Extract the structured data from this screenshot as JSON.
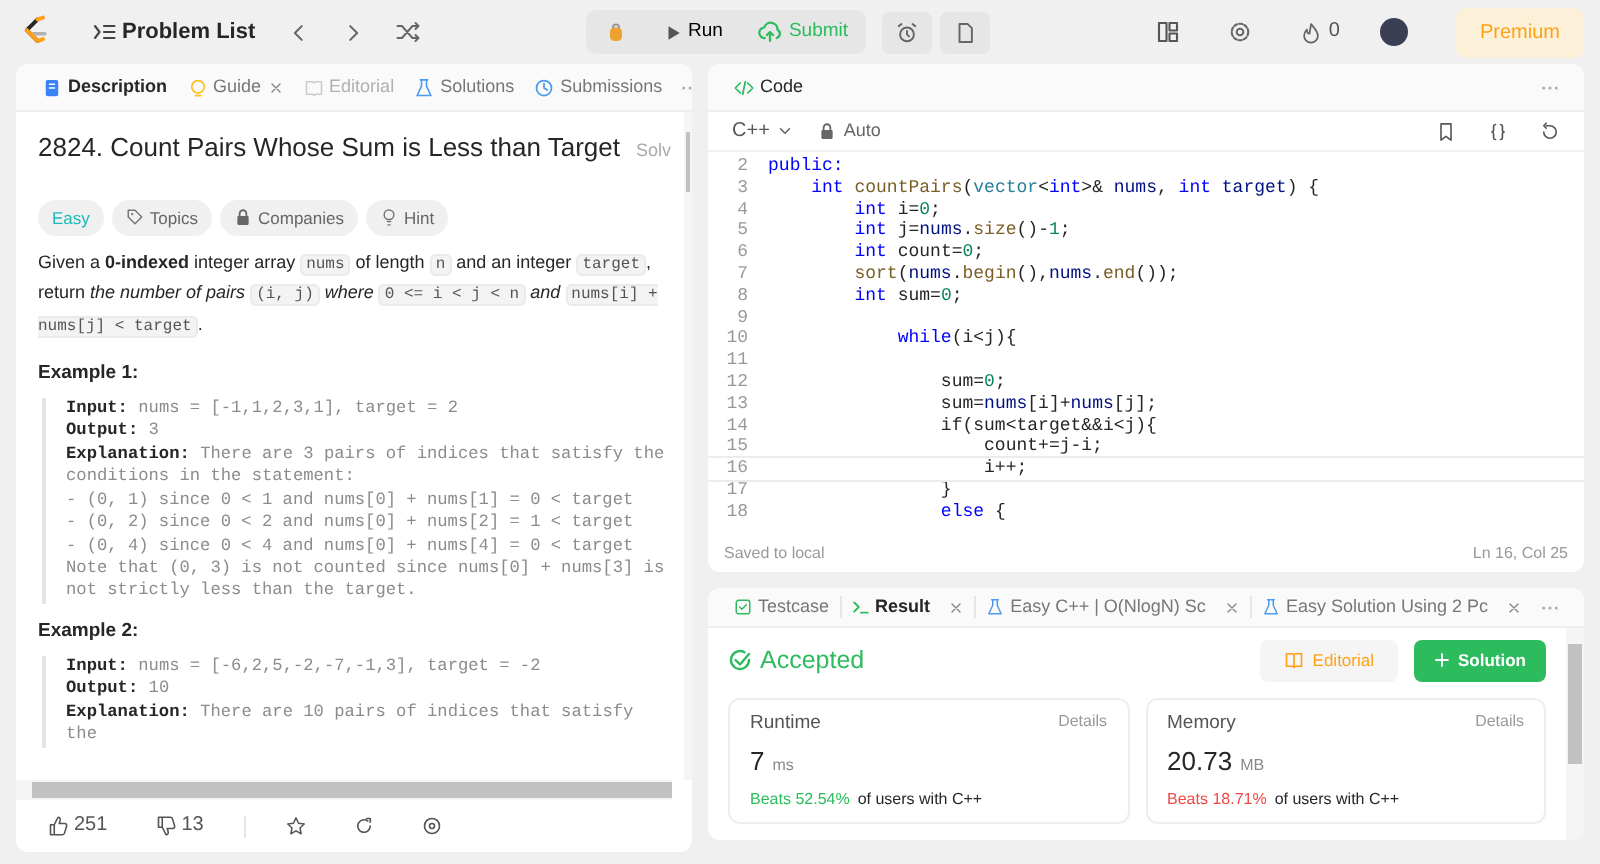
{
  "topbar": {
    "problem_list": "Problem List",
    "run": "Run",
    "submit": "Submit",
    "points": "0",
    "premium": "Premium"
  },
  "description": {
    "tabs": [
      {
        "label": "Description",
        "selected": true,
        "disabled": false,
        "closable": false
      },
      {
        "label": "Guide",
        "selected": false,
        "disabled": false,
        "closable": true
      },
      {
        "label": "Editorial",
        "selected": false,
        "disabled": true,
        "closable": false
      },
      {
        "label": "Solutions",
        "selected": false,
        "disabled": false,
        "closable": false
      },
      {
        "label": "Submissions",
        "selected": false,
        "disabled": false,
        "closable": false
      }
    ],
    "title": "2824. Count Pairs Whose Sum is Less than Target",
    "title_cut": "Solv",
    "tags": [
      {
        "label": "Easy",
        "kind": "difficulty"
      },
      {
        "label": "Topics",
        "kind": "topics"
      },
      {
        "label": "Companies",
        "kind": "companies"
      },
      {
        "label": "Hint",
        "kind": "hint"
      }
    ],
    "statement": [
      {
        "t": "Given a ",
        "kind": "text"
      },
      {
        "t": "0-indexed",
        "kind": "bold"
      },
      {
        "t": " integer array ",
        "kind": "text"
      },
      {
        "t": "nums",
        "kind": "code"
      },
      {
        "t": " of length ",
        "kind": "text"
      },
      {
        "t": "n",
        "kind": "code"
      },
      {
        "t": " and an integer ",
        "kind": "text"
      },
      {
        "t": "target",
        "kind": "code"
      },
      {
        "t": ", return ",
        "kind": "text"
      },
      {
        "t": "the number of pairs ",
        "kind": "italic"
      },
      {
        "t": "(i, j)",
        "kind": "code"
      },
      {
        "t": " where ",
        "kind": "italic"
      },
      {
        "t": "0 <= i < j < n",
        "kind": "code"
      },
      {
        "t": " and ",
        "kind": "italic"
      },
      {
        "t": "nums[i] + nums[j] < target",
        "kind": "code"
      },
      {
        "t": ".",
        "kind": "text"
      }
    ],
    "examples": [
      {
        "title": "Example 1:",
        "lines": [
          {
            "label": "Input:",
            "text": "nums = [-1,1,2,3,1], target = 2"
          },
          {
            "label": "Output:",
            "text": "3"
          },
          {
            "label": "Explanation:",
            "text": "There are 3 pairs of indices that satisfy the conditions in the statement:"
          },
          {
            "text": "- (0, 1) since 0 < 1 and nums[0] + nums[1] = 0 < target"
          },
          {
            "text": "- (0, 2) since 0 < 2 and nums[0] + nums[2] = 1 < target"
          },
          {
            "text": "- (0, 4) since 0 < 4 and nums[0] + nums[4] = 0 < target"
          },
          {
            "text": "Note that (0, 3) is not counted since nums[0] + nums[3] is not strictly less than the target."
          }
        ]
      },
      {
        "title": "Example 2:",
        "lines": [
          {
            "label": "Input:",
            "text": "nums = [-6,2,5,-2,-7,-1,3], target = -2"
          },
          {
            "label": "Output:",
            "text": "10"
          },
          {
            "label": "Explanation:",
            "text": "There are 10 pairs of indices that satisfy the"
          }
        ]
      }
    ],
    "likes": "251",
    "dislikes": "13"
  },
  "code": {
    "title": "Code",
    "language": "C++",
    "mode": "Auto",
    "lines": [
      {
        "no": "2",
        "current": false,
        "tokens": [
          {
            "kind": "kw",
            "t": "public:"
          }
        ]
      },
      {
        "no": "3",
        "current": false,
        "tokens": [
          {
            "kind": "kw",
            "t": "    int"
          },
          {
            "kind": "fn",
            "t": " countPairs"
          },
          {
            "kind": "pl",
            "t": "("
          },
          {
            "kind": "ty",
            "t": "vector"
          },
          {
            "kind": "pl",
            "t": "<"
          },
          {
            "kind": "kw",
            "t": "int"
          },
          {
            "kind": "pl",
            "t": ">& "
          },
          {
            "kind": "var",
            "t": "nums"
          },
          {
            "kind": "pl",
            "t": ", "
          },
          {
            "kind": "kw",
            "t": "int"
          },
          {
            "kind": "var",
            "t": " target"
          },
          {
            "kind": "pl",
            "t": ") {"
          }
        ]
      },
      {
        "no": "4",
        "current": false,
        "tokens": [
          {
            "kind": "kw",
            "t": "        int"
          },
          {
            "kind": "pl",
            "t": " i="
          },
          {
            "kind": "num",
            "t": "0"
          },
          {
            "kind": "pl",
            "t": ";"
          }
        ]
      },
      {
        "no": "5",
        "current": false,
        "tokens": [
          {
            "kind": "kw",
            "t": "        int"
          },
          {
            "kind": "pl",
            "t": " j="
          },
          {
            "kind": "var",
            "t": "nums"
          },
          {
            "kind": "pl",
            "t": "."
          },
          {
            "kind": "fn",
            "t": "size"
          },
          {
            "kind": "pl",
            "t": "()-"
          },
          {
            "kind": "num",
            "t": "1"
          },
          {
            "kind": "pl",
            "t": ";"
          }
        ]
      },
      {
        "no": "6",
        "current": false,
        "tokens": [
          {
            "kind": "kw",
            "t": "        int"
          },
          {
            "kind": "pl",
            "t": " count="
          },
          {
            "kind": "num",
            "t": "0"
          },
          {
            "kind": "pl",
            "t": ";"
          }
        ]
      },
      {
        "no": "7",
        "current": false,
        "tokens": [
          {
            "kind": "fn",
            "t": "        sort"
          },
          {
            "kind": "pl",
            "t": "("
          },
          {
            "kind": "var",
            "t": "nums"
          },
          {
            "kind": "pl",
            "t": "."
          },
          {
            "kind": "fn",
            "t": "begin"
          },
          {
            "kind": "pl",
            "t": "(),"
          },
          {
            "kind": "var",
            "t": "nums"
          },
          {
            "kind": "pl",
            "t": "."
          },
          {
            "kind": "fn",
            "t": "end"
          },
          {
            "kind": "pl",
            "t": "());"
          }
        ]
      },
      {
        "no": "8",
        "current": false,
        "tokens": [
          {
            "kind": "kw",
            "t": "        int"
          },
          {
            "kind": "pl",
            "t": " sum="
          },
          {
            "kind": "num",
            "t": "0"
          },
          {
            "kind": "pl",
            "t": ";"
          }
        ]
      },
      {
        "no": "9",
        "current": false
      },
      {
        "no": "10",
        "current": false,
        "tokens": [
          {
            "kind": "kw",
            "t": "            while"
          },
          {
            "kind": "pl",
            "t": "(i<j){"
          }
        ]
      },
      {
        "no": "11",
        "current": false
      },
      {
        "no": "12",
        "current": false,
        "tokens": [
          {
            "kind": "pl",
            "t": "                sum="
          },
          {
            "kind": "num",
            "t": "0"
          },
          {
            "kind": "pl",
            "t": ";"
          }
        ]
      },
      {
        "no": "13",
        "current": false,
        "tokens": [
          {
            "kind": "pl",
            "t": "                sum="
          },
          {
            "kind": "var",
            "t": "nums"
          },
          {
            "kind": "pl",
            "t": "[i]+"
          },
          {
            "kind": "var",
            "t": "nums"
          },
          {
            "kind": "pl",
            "t": "[j];"
          }
        ]
      },
      {
        "no": "14",
        "current": false,
        "tokens": [
          {
            "kind": "pl",
            "t": "                if(sum<target&&i<j){"
          }
        ]
      },
      {
        "no": "15",
        "current": false,
        "tokens": [
          {
            "kind": "pl",
            "t": "                    count+=j-i;"
          }
        ]
      },
      {
        "no": "16",
        "current": true,
        "tokens": [
          {
            "kind": "pl",
            "t": "                    i++;"
          }
        ]
      },
      {
        "no": "17",
        "current": false,
        "tokens": [
          {
            "kind": "pl",
            "t": "                }"
          }
        ]
      },
      {
        "no": "18",
        "current": false,
        "tokens": [
          {
            "kind": "kw",
            "t": "                else"
          },
          {
            "kind": "pl",
            "t": " {"
          }
        ]
      }
    ],
    "saved": "Saved to local",
    "cursor": "Ln 16, Col 25"
  },
  "result": {
    "tabs": [
      {
        "label": "Testcase",
        "selected": false,
        "closable": false
      },
      {
        "label": "Result",
        "selected": true,
        "closable": true
      },
      {
        "label": "Easy C++ | O(NlogN) Sc",
        "selected": false,
        "closable": true
      },
      {
        "label": "Easy Solution Using 2 Pc",
        "selected": false,
        "closable": true
      }
    ],
    "status": "Accepted",
    "editorial": "Editorial",
    "solution": "Solution",
    "stats": [
      {
        "label": "Runtime",
        "details": "Details",
        "value": "7",
        "unit": "ms",
        "beats": "Beats 52.54%",
        "suffix": "of users with C++",
        "color": "#2cbb5d"
      },
      {
        "label": "Memory",
        "details": "Details",
        "value": "20.73",
        "unit": "MB",
        "beats": "Beats 18.71%",
        "suffix": "of users with C++",
        "color": "#ef4743"
      }
    ]
  }
}
